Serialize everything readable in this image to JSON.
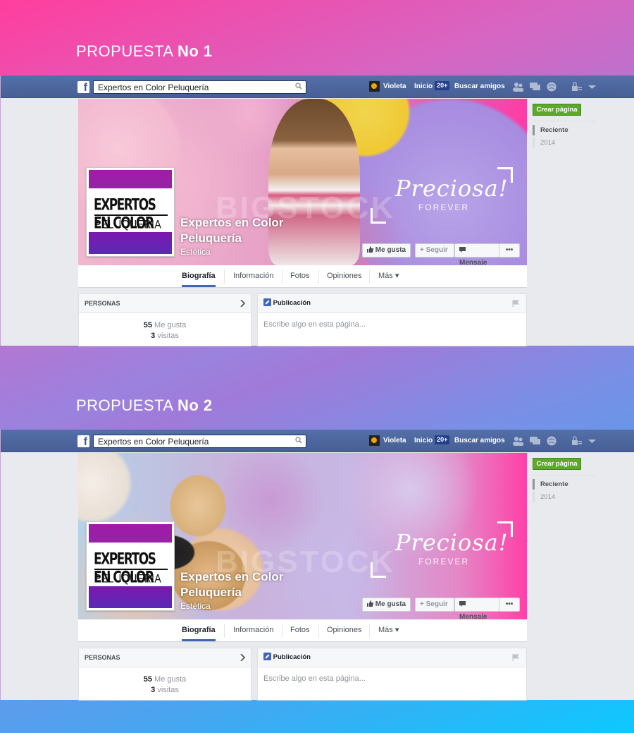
{
  "proposals": [
    {
      "title_prefix": "PROPUESTA",
      "title_strong": "No 1",
      "search_value": "Expertos en Color Peluquería",
      "user_name": "Violeta",
      "home_label": "Inicio",
      "home_badge": "20+",
      "find_friends": "Buscar amigos",
      "cover_text": "Preciosa!",
      "cover_sub": "FOREVER",
      "watermark": "BIGSTOCK",
      "page_name": "Expertos en Color Peluquería",
      "page_category": "Estética",
      "logo_line1": "EXPERTOS EN COLOR",
      "logo_line2": "PELUQUERIA",
      "btn_like": "Me gusta",
      "btn_follow": "Seguir",
      "btn_message": "Mensaje",
      "btn_more": "•••",
      "tabs": [
        "Biografía",
        "Información",
        "Fotos",
        "Opiniones",
        "Más ▾"
      ],
      "people_head": "PERSONAS",
      "likes_count": "55",
      "likes_label": "Me gusta",
      "visits_count": "3",
      "visits_label": "visitas",
      "post_head": "Publicación",
      "post_placeholder": "Escribe algo en esta página...",
      "create_page": "Crear página",
      "timeline": [
        "Reciente",
        "2014"
      ]
    },
    {
      "title_prefix": "PROPUESTA",
      "title_strong": "No 2",
      "search_value": "Expertos en Color Peluquería",
      "user_name": "Violeta",
      "home_label": "Inicio",
      "home_badge": "20+",
      "find_friends": "Buscar amigos",
      "cover_text": "Preciosa!",
      "cover_sub": "FOREVER",
      "watermark": "BIGSTOCK",
      "page_name": "Expertos en Color Peluquería",
      "page_category": "Estética",
      "logo_line1": "EXPERTOS EN COLOR",
      "logo_line2": "PELUQUERIA",
      "btn_like": "Me gusta",
      "btn_follow": "Seguir",
      "btn_message": "Mensaje",
      "btn_more": "•••",
      "tabs": [
        "Biografía",
        "Información",
        "Fotos",
        "Opiniones",
        "Más ▾"
      ],
      "people_head": "PERSONAS",
      "likes_count": "55",
      "likes_label": "Me gusta",
      "visits_count": "3",
      "visits_label": "visitas",
      "post_head": "Publicación",
      "post_placeholder": "Escribe algo en esta página...",
      "create_page": "Crear página",
      "timeline": [
        "Reciente",
        "2014"
      ]
    }
  ],
  "colors": {
    "fb_blue": "#4e69a2",
    "create_green": "#5fa82b",
    "active_tab": "#4267b2"
  },
  "icons": [
    "facebook-logo-icon",
    "search-icon",
    "friend-requests-icon",
    "messages-icon",
    "notifications-icon",
    "privacy-icon",
    "account-menu-icon",
    "thumbs-up-icon",
    "plus-icon",
    "message-icon",
    "chevron-right-icon",
    "pencil-icon",
    "flag-icon"
  ]
}
